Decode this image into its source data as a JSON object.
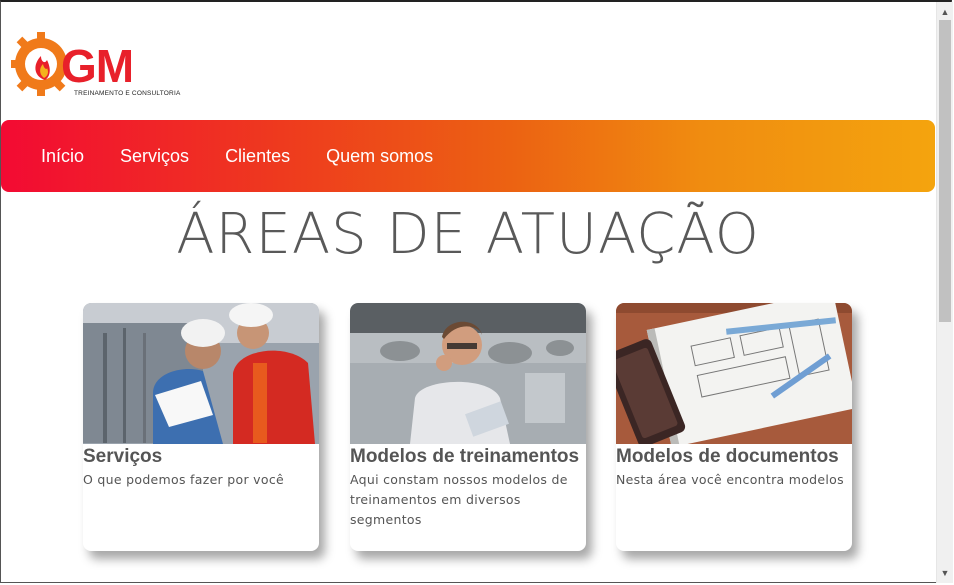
{
  "brand": {
    "logo_text": "GM",
    "logo_subtitle": "TREINAMENTO E CONSULTORIA"
  },
  "nav": {
    "items": [
      {
        "label": "Início"
      },
      {
        "label": "Serviços"
      },
      {
        "label": "Clientes"
      },
      {
        "label": "Quem somos"
      }
    ]
  },
  "main": {
    "title": "ÁREAS DE ATUAÇÃO",
    "cards": [
      {
        "title": "Serviços",
        "description": "O que podemos fazer por você"
      },
      {
        "title": "Modelos de treinamentos",
        "description": "Aqui constam nossos modelos de treinamentos em diversos segmentos"
      },
      {
        "title": "Modelos de documentos",
        "description": "Nesta área você encontra modelos"
      }
    ]
  },
  "colors": {
    "nav_gradient_start": "#f30a33",
    "nav_gradient_end": "#f4a40e",
    "logo_red": "#e8202a",
    "logo_orange": "#f07a1a",
    "text_gray": "#555555"
  },
  "icons": {
    "scroll_up": "▲",
    "scroll_down": "▼"
  }
}
